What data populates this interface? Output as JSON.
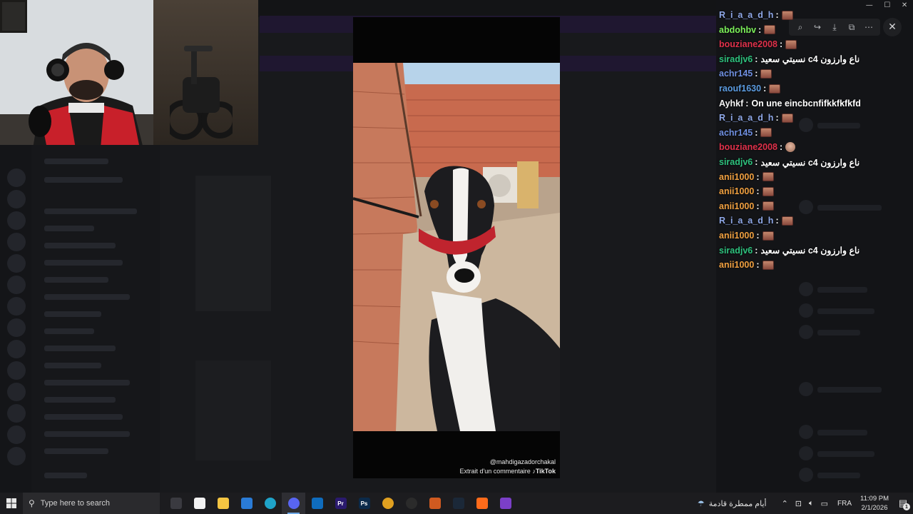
{
  "window": {
    "controls": [
      "—",
      "☐",
      "✕"
    ]
  },
  "viewer": {
    "tiktok_handle": "@mahdigazadorchakal",
    "extract_caption": "Extrait d'un commentaire",
    "tiktok_brand": "TikTok",
    "toolbar": {
      "zoom_icon": "zoom-icon",
      "forward_icon": "share-forward-icon",
      "download_icon": "download-icon",
      "open_external_icon": "open-external-icon",
      "more_icon": "more-options-icon",
      "close_icon": "close-icon"
    }
  },
  "chat": {
    "messages": [
      {
        "user": "R_i_a_a_d_h",
        "color": "#8fa8e8",
        "sep": ":",
        "text": "",
        "emote": "emote"
      },
      {
        "user": "abdohbv",
        "color": "#7cf05a",
        "sep": ":",
        "text": "",
        "emote": "emote"
      },
      {
        "user": "bouziane2008",
        "color": "#e0314b",
        "sep": ":",
        "text": "",
        "emote": "emote"
      },
      {
        "user": "siradjv6",
        "color": "#2ec27e",
        "sep": ":",
        "text": "ناع وارزون c4 نسيتي سعيد",
        "emote": ""
      },
      {
        "user": "achr145",
        "color": "#6f8fe0",
        "sep": ":",
        "text": "",
        "emote": "emote"
      },
      {
        "user": "raouf1630",
        "color": "#5b9be0",
        "sep": ":",
        "text": "",
        "emote": "emote"
      },
      {
        "user": "Ayhkf",
        "color": "#f2f2f2",
        "sep": ":",
        "text": "On une eincbcnfifkkfkfkfd",
        "emote": ""
      },
      {
        "user": "R_i_a_a_d_h",
        "color": "#8fa8e8",
        "sep": ":",
        "text": "",
        "emote": "emote"
      },
      {
        "user": "achr145",
        "color": "#6f8fe0",
        "sep": ":",
        "text": "",
        "emote": "emote"
      },
      {
        "user": "bouziane2008",
        "color": "#e0314b",
        "sep": ":",
        "text": "",
        "emote": "skull"
      },
      {
        "user": "siradjv6",
        "color": "#2ec27e",
        "sep": ":",
        "text": "ناع وارزون c4 نسيتي سعيد",
        "emote": ""
      },
      {
        "user": "anii1000",
        "color": "#f0a040",
        "sep": ":",
        "text": "",
        "emote": "emote"
      },
      {
        "user": "anii1000",
        "color": "#f0a040",
        "sep": ":",
        "text": "",
        "emote": "emote"
      },
      {
        "user": "anii1000",
        "color": "#f0a040",
        "sep": ":",
        "text": "",
        "emote": "emote"
      },
      {
        "user": "R_i_a_a_d_h",
        "color": "#8fa8e8",
        "sep": ":",
        "text": "",
        "emote": "emote"
      },
      {
        "user": "anii1000",
        "color": "#f0a040",
        "sep": ":",
        "text": "",
        "emote": "emote"
      },
      {
        "user": "siradjv6",
        "color": "#2ec27e",
        "sep": ":",
        "text": "ناع وارزون c4 نسيتي سعيد",
        "emote": ""
      },
      {
        "user": "anii1000",
        "color": "#f0a040",
        "sep": ":",
        "text": "",
        "emote": "emote"
      }
    ]
  },
  "taskbar": {
    "search_placeholder": "Type here to search",
    "apps": [
      {
        "name": "task-view",
        "label": "",
        "color": "#3a3a40"
      },
      {
        "name": "microsoft-store",
        "label": "",
        "color": "#f2f2f2"
      },
      {
        "name": "file-explorer",
        "label": "",
        "color": "#f5c542"
      },
      {
        "name": "ms-store-app",
        "label": "",
        "color": "#2a7bd6"
      },
      {
        "name": "edge",
        "label": "",
        "color": "#1fa3c9"
      },
      {
        "name": "discord",
        "label": "",
        "color": "#5865f2",
        "active": true
      },
      {
        "name": "outlook",
        "label": "",
        "color": "#0f6cbd"
      },
      {
        "name": "premiere-pro",
        "label": "Pr",
        "color": "#2a1a6e"
      },
      {
        "name": "photoshop",
        "label": "Ps",
        "color": "#0b2a4a"
      },
      {
        "name": "chrome",
        "label": "",
        "color": "#e0a020"
      },
      {
        "name": "obs",
        "label": "",
        "color": "#2b2b2b"
      },
      {
        "name": "app-orange",
        "label": "",
        "color": "#d05a20"
      },
      {
        "name": "steam",
        "label": "",
        "color": "#1b2838"
      },
      {
        "name": "app-avast",
        "label": "",
        "color": "#ff6b1a"
      },
      {
        "name": "app-purple",
        "label": "",
        "color": "#7b3fc8"
      }
    ],
    "weather_text": "أيام ممطرة قادمة",
    "language": "FRA",
    "time": "11:09 PM",
    "date": "2/1/2026",
    "notification_count": "1"
  }
}
